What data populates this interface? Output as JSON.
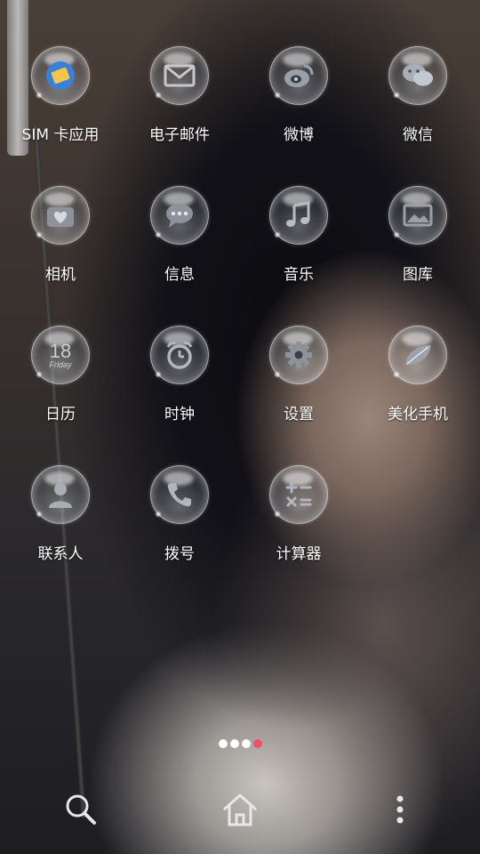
{
  "apps": [
    {
      "id": "sim",
      "label": "SIM 卡应用",
      "icon": "sim-card-icon"
    },
    {
      "id": "email",
      "label": "电子邮件",
      "icon": "mail-icon"
    },
    {
      "id": "weibo",
      "label": "微博",
      "icon": "weibo-icon"
    },
    {
      "id": "wechat",
      "label": "微信",
      "icon": "wechat-icon"
    },
    {
      "id": "camera",
      "label": "相机",
      "icon": "camera-icon"
    },
    {
      "id": "messages",
      "label": "信息",
      "icon": "message-icon"
    },
    {
      "id": "music",
      "label": "音乐",
      "icon": "music-note-icon"
    },
    {
      "id": "gallery",
      "label": "图库",
      "icon": "gallery-icon"
    },
    {
      "id": "calendar",
      "label": "日历",
      "icon": "calendar-icon",
      "day": "18",
      "weekday": "Friday"
    },
    {
      "id": "clock",
      "label": "时钟",
      "icon": "alarm-clock-icon"
    },
    {
      "id": "settings",
      "label": "设置",
      "icon": "gear-icon"
    },
    {
      "id": "theme",
      "label": "美化手机",
      "icon": "theme-leaf-icon"
    },
    {
      "id": "contacts",
      "label": "联系人",
      "icon": "contact-person-icon"
    },
    {
      "id": "dialer",
      "label": "拨号",
      "icon": "phone-icon"
    },
    {
      "id": "calculator",
      "label": "计算器",
      "icon": "calculator-icon"
    }
  ],
  "pager": {
    "count": 4,
    "active_index": 3,
    "active_color": "#f0506e"
  },
  "dock": [
    {
      "id": "search",
      "icon": "search-icon"
    },
    {
      "id": "home",
      "icon": "home-icon"
    },
    {
      "id": "menu",
      "icon": "more-vertical-icon"
    }
  ]
}
